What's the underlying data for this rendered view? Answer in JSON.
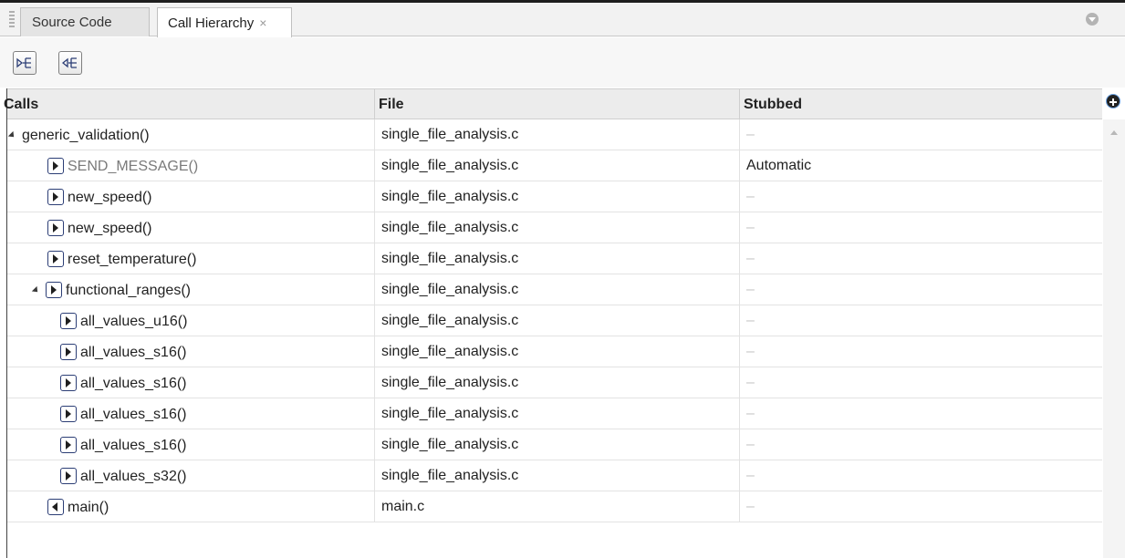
{
  "tabs": [
    {
      "label": "Source Code",
      "active": false
    },
    {
      "label": "Call Hierarchy",
      "active": true,
      "close": "×"
    }
  ],
  "toolbar": {
    "show_callees_icon": "callees-icon",
    "show_callers_icon": "callers-icon"
  },
  "table": {
    "headers": {
      "calls": "Calls",
      "file": "File",
      "stubbed": "Stubbed"
    },
    "rows": [
      {
        "name": "generic_validation()",
        "file": "single_file_analysis.c",
        "stubbed": "–",
        "level": 0,
        "expanded": true,
        "icon": "none"
      },
      {
        "name": "SEND_MESSAGE()",
        "file": "single_file_analysis.c",
        "stubbed": "Automatic",
        "level": 1,
        "icon": "callee-icon",
        "stubbed_call": true
      },
      {
        "name": "new_speed()",
        "file": "single_file_analysis.c",
        "stubbed": "–",
        "level": 1,
        "icon": "callee-icon"
      },
      {
        "name": "new_speed()",
        "file": "single_file_analysis.c",
        "stubbed": "–",
        "level": 1,
        "icon": "callee-icon"
      },
      {
        "name": "reset_temperature()",
        "file": "single_file_analysis.c",
        "stubbed": "–",
        "level": 1,
        "icon": "callee-icon"
      },
      {
        "name": "functional_ranges()",
        "file": "single_file_analysis.c",
        "stubbed": "–",
        "level": 1,
        "expanded": true,
        "icon": "callee-icon"
      },
      {
        "name": "all_values_u16()",
        "file": "single_file_analysis.c",
        "stubbed": "–",
        "level": 2,
        "icon": "callee-icon"
      },
      {
        "name": "all_values_s16()",
        "file": "single_file_analysis.c",
        "stubbed": "–",
        "level": 2,
        "icon": "callee-icon"
      },
      {
        "name": "all_values_s16()",
        "file": "single_file_analysis.c",
        "stubbed": "–",
        "level": 2,
        "icon": "callee-icon"
      },
      {
        "name": "all_values_s16()",
        "file": "single_file_analysis.c",
        "stubbed": "–",
        "level": 2,
        "icon": "callee-icon"
      },
      {
        "name": "all_values_s16()",
        "file": "single_file_analysis.c",
        "stubbed": "–",
        "level": 2,
        "icon": "callee-icon"
      },
      {
        "name": "all_values_s32()",
        "file": "single_file_analysis.c",
        "stubbed": "–",
        "level": 2,
        "icon": "callee-icon"
      },
      {
        "name": "main()",
        "file": "main.c",
        "stubbed": "–",
        "level": 1,
        "icon": "caller-icon"
      }
    ]
  }
}
